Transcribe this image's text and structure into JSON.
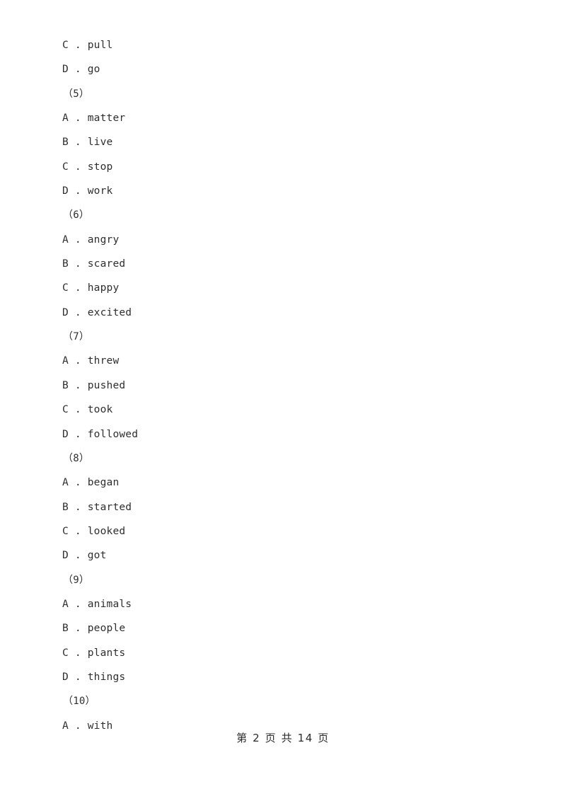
{
  "document": {
    "type": "exam-paper",
    "page_background": "#ffffff",
    "text_color": "#2e2e2e"
  },
  "body_lines": [
    {
      "kind": "option",
      "text": "C . pull"
    },
    {
      "kind": "option",
      "text": "D . go"
    },
    {
      "kind": "question",
      "text": "（5）"
    },
    {
      "kind": "option",
      "text": "A . matter"
    },
    {
      "kind": "option",
      "text": "B . live"
    },
    {
      "kind": "option",
      "text": "C . stop"
    },
    {
      "kind": "option",
      "text": "D . work"
    },
    {
      "kind": "question",
      "text": "（6）"
    },
    {
      "kind": "option",
      "text": "A . angry"
    },
    {
      "kind": "option",
      "text": "B . scared"
    },
    {
      "kind": "option",
      "text": "C . happy"
    },
    {
      "kind": "option",
      "text": "D . excited"
    },
    {
      "kind": "question",
      "text": "（7）"
    },
    {
      "kind": "option",
      "text": "A . threw"
    },
    {
      "kind": "option",
      "text": "B . pushed"
    },
    {
      "kind": "option",
      "text": "C . took"
    },
    {
      "kind": "option",
      "text": "D . followed"
    },
    {
      "kind": "question",
      "text": "（8）"
    },
    {
      "kind": "option",
      "text": "A . began"
    },
    {
      "kind": "option",
      "text": "B . started"
    },
    {
      "kind": "option",
      "text": "C . looked"
    },
    {
      "kind": "option",
      "text": "D . got"
    },
    {
      "kind": "question",
      "text": "（9）"
    },
    {
      "kind": "option",
      "text": "A . animals"
    },
    {
      "kind": "option",
      "text": "B . people"
    },
    {
      "kind": "option",
      "text": "C . plants"
    },
    {
      "kind": "option",
      "text": "D . things"
    },
    {
      "kind": "question",
      "text": "（10）"
    },
    {
      "kind": "option",
      "text": "A . with"
    }
  ],
  "footer": {
    "text": "第 2 页 共 14 页",
    "current_page": "2",
    "total_pages": "14"
  }
}
